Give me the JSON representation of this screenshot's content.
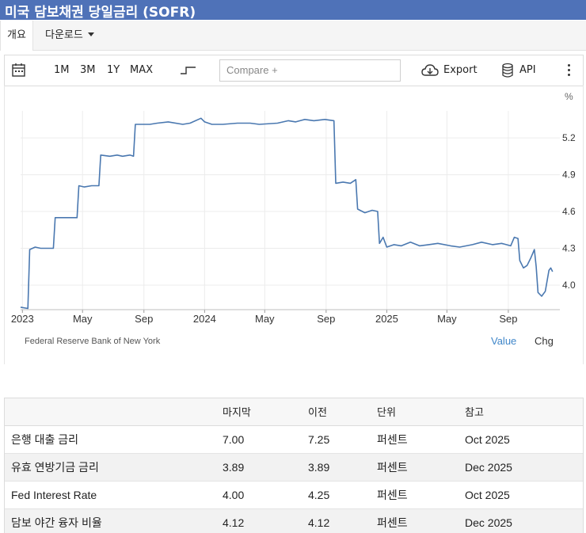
{
  "title": "미국 담보채권 당일금리 (SOFR)",
  "tabs": {
    "overview": "개요",
    "download": "다운로드"
  },
  "toolbar": {
    "ranges": [
      "1M",
      "3M",
      "1Y",
      "MAX"
    ],
    "compare_placeholder": "Compare +",
    "export_label": "Export",
    "api_label": "API"
  },
  "chart_data": {
    "type": "line",
    "unit": "%",
    "source": "Federal Reserve Bank of New York",
    "y_ticks": [
      4.0,
      4.3,
      4.6,
      4.9,
      5.2
    ],
    "ylim": [
      3.8,
      5.42
    ],
    "x_ticks": [
      {
        "label": "2023",
        "x": 2023.0
      },
      {
        "label": "May",
        "x": 2023.33
      },
      {
        "label": "Sep",
        "x": 2023.667
      },
      {
        "label": "2024",
        "x": 2024.0
      },
      {
        "label": "May",
        "x": 2024.33
      },
      {
        "label": "Sep",
        "x": 2024.667
      },
      {
        "label": "2025",
        "x": 2025.0
      },
      {
        "label": "May",
        "x": 2025.33
      },
      {
        "label": "Sep",
        "x": 2025.667
      }
    ],
    "xlim": [
      2022.99,
      2025.95
    ],
    "series": [
      {
        "color": "#4a78b0",
        "points": [
          [
            2022.99,
            3.82
          ],
          [
            2023.03,
            3.81
          ],
          [
            2023.04,
            4.29
          ],
          [
            2023.07,
            4.31
          ],
          [
            2023.1,
            4.3
          ],
          [
            2023.13,
            4.3
          ],
          [
            2023.17,
            4.3
          ],
          [
            2023.18,
            4.55
          ],
          [
            2023.25,
            4.55
          ],
          [
            2023.3,
            4.55
          ],
          [
            2023.31,
            4.81
          ],
          [
            2023.34,
            4.8
          ],
          [
            2023.38,
            4.81
          ],
          [
            2023.42,
            4.81
          ],
          [
            2023.43,
            5.06
          ],
          [
            2023.48,
            5.05
          ],
          [
            2023.52,
            5.06
          ],
          [
            2023.55,
            5.05
          ],
          [
            2023.59,
            5.06
          ],
          [
            2023.61,
            5.05
          ],
          [
            2023.62,
            5.31
          ],
          [
            2023.7,
            5.31
          ],
          [
            2023.74,
            5.32
          ],
          [
            2023.8,
            5.33
          ],
          [
            2023.88,
            5.31
          ],
          [
            2023.92,
            5.32
          ],
          [
            2023.98,
            5.36
          ],
          [
            2024.0,
            5.33
          ],
          [
            2024.04,
            5.31
          ],
          [
            2024.1,
            5.31
          ],
          [
            2024.18,
            5.32
          ],
          [
            2024.25,
            5.32
          ],
          [
            2024.3,
            5.31
          ],
          [
            2024.4,
            5.32
          ],
          [
            2024.46,
            5.34
          ],
          [
            2024.5,
            5.33
          ],
          [
            2024.55,
            5.35
          ],
          [
            2024.6,
            5.34
          ],
          [
            2024.66,
            5.35
          ],
          [
            2024.71,
            5.34
          ],
          [
            2024.72,
            4.83
          ],
          [
            2024.76,
            4.84
          ],
          [
            2024.8,
            4.83
          ],
          [
            2024.83,
            4.86
          ],
          [
            2024.84,
            4.62
          ],
          [
            2024.88,
            4.59
          ],
          [
            2024.92,
            4.61
          ],
          [
            2024.95,
            4.6
          ],
          [
            2024.96,
            4.34
          ],
          [
            2024.98,
            4.39
          ],
          [
            2025.0,
            4.31
          ],
          [
            2025.04,
            4.33
          ],
          [
            2025.08,
            4.32
          ],
          [
            2025.13,
            4.35
          ],
          [
            2025.18,
            4.32
          ],
          [
            2025.23,
            4.33
          ],
          [
            2025.28,
            4.34
          ],
          [
            2025.35,
            4.32
          ],
          [
            2025.4,
            4.31
          ],
          [
            2025.47,
            4.33
          ],
          [
            2025.52,
            4.35
          ],
          [
            2025.58,
            4.33
          ],
          [
            2025.63,
            4.34
          ],
          [
            2025.68,
            4.32
          ],
          [
            2025.7,
            4.39
          ],
          [
            2025.72,
            4.38
          ],
          [
            2025.73,
            4.2
          ],
          [
            2025.75,
            4.14
          ],
          [
            2025.77,
            4.16
          ],
          [
            2025.79,
            4.22
          ],
          [
            2025.81,
            4.29
          ],
          [
            2025.82,
            4.15
          ],
          [
            2025.83,
            3.94
          ],
          [
            2025.85,
            3.91
          ],
          [
            2025.87,
            3.95
          ],
          [
            2025.89,
            4.12
          ],
          [
            2025.9,
            4.14
          ],
          [
            2025.91,
            4.11
          ]
        ]
      }
    ],
    "legend": {
      "value_label": "Value",
      "chg_label": "Chg"
    }
  },
  "table": {
    "headers": [
      "",
      "마지막",
      "이전",
      "단위",
      "참고"
    ],
    "rows": [
      [
        "은행 대출 금리",
        "7.00",
        "7.25",
        "퍼센트",
        "Oct 2025"
      ],
      [
        "유효 연방기금 금리",
        "3.89",
        "3.89",
        "퍼센트",
        "Dec 2025"
      ],
      [
        "Fed Interest Rate",
        "4.00",
        "4.25",
        "퍼센트",
        "Oct 2025"
      ],
      [
        "담보 야간 융자 비율",
        "4.12",
        "4.12",
        "퍼센트",
        "Dec 2025"
      ]
    ]
  },
  "colors": {
    "title_bar": "#4f72b8",
    "line": "#4a78b0",
    "value_label": "#3f86c9"
  }
}
